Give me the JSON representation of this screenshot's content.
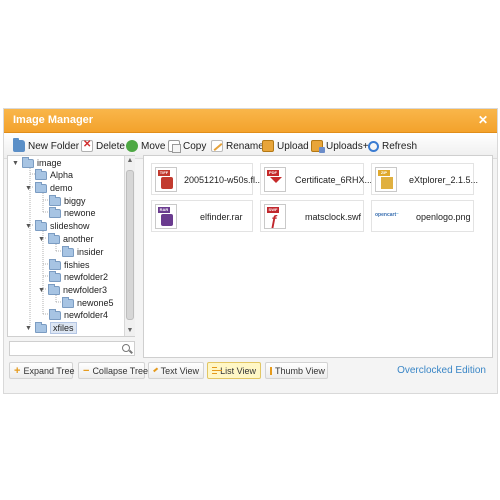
{
  "window": {
    "title": "Image Manager",
    "close_glyph": "✕"
  },
  "toolbar": {
    "buttons": [
      {
        "label": "New Folder",
        "icon": "new-folder-icon"
      },
      {
        "label": "Delete",
        "icon": "delete-icon"
      },
      {
        "label": "Move",
        "icon": "move-icon"
      },
      {
        "label": "Copy",
        "icon": "copy-icon"
      },
      {
        "label": "Rename",
        "icon": "rename-icon"
      },
      {
        "label": "Upload",
        "icon": "upload-icon"
      },
      {
        "label": "Uploads+",
        "icon": "uploads-plus-icon"
      },
      {
        "label": "Refresh",
        "icon": "refresh-icon"
      }
    ]
  },
  "tree": {
    "items": [
      {
        "label": "image",
        "expanded": true
      },
      {
        "label": "Alpha"
      },
      {
        "label": "demo",
        "expanded": true
      },
      {
        "label": "biggy"
      },
      {
        "label": "newone"
      },
      {
        "label": "slideshow",
        "expanded": true
      },
      {
        "label": "another",
        "expanded": true
      },
      {
        "label": "insider"
      },
      {
        "label": "fishies"
      },
      {
        "label": "newfolder2"
      },
      {
        "label": "newfolder3",
        "expanded": true
      },
      {
        "label": "newone5"
      },
      {
        "label": "newfolder4"
      },
      {
        "label": "xfiles",
        "expanded": true,
        "selected": true
      }
    ]
  },
  "search": {
    "value": "",
    "placeholder": ""
  },
  "files": [
    {
      "name": "20051210-w50s.fl...",
      "type": "tiff",
      "badge": "TIFF"
    },
    {
      "name": "Certificate_6RHX...",
      "type": "pdf",
      "badge": "PDF"
    },
    {
      "name": "eXtplorer_2.1.5...",
      "type": "zip",
      "badge": "ZIP"
    },
    {
      "name": "elfinder.rar",
      "type": "rar",
      "badge": "RAR"
    },
    {
      "name": "matsclock.swf",
      "type": "swf",
      "badge": "SWF"
    },
    {
      "name": "openlogo.png",
      "type": "png",
      "badge": ""
    }
  ],
  "bottom_bar": {
    "buttons": [
      {
        "label": "Expand Tree",
        "active": false
      },
      {
        "label": "Collapse Tree",
        "active": false
      },
      {
        "label": "Text View",
        "active": false
      },
      {
        "label": "List View",
        "active": true
      },
      {
        "label": "Thumb View",
        "active": false
      }
    ]
  },
  "edition_label": "Overclocked Edition",
  "colors": {
    "title_bar": "#f3a22c",
    "link": "#3a86c6",
    "active_button": "#fff7c6"
  }
}
